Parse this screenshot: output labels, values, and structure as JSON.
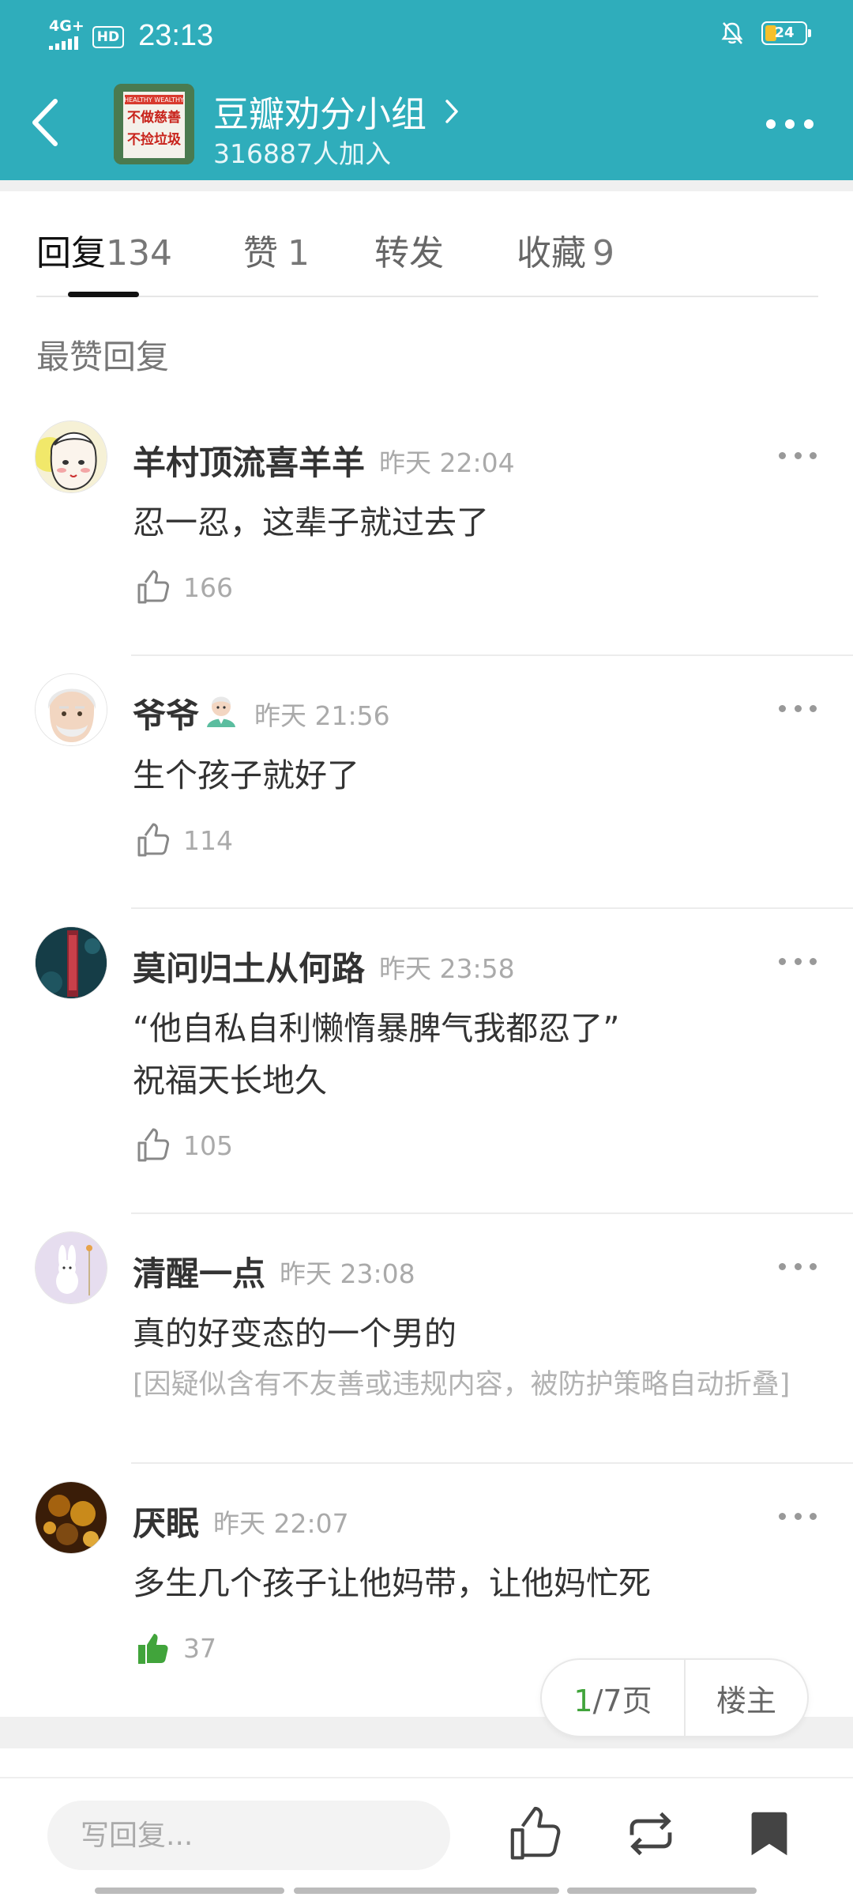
{
  "status_bar": {
    "network": "4G+",
    "hd": "HD",
    "time": "23:13",
    "battery": "24",
    "icons": [
      "signal-icon",
      "bell-off-icon",
      "battery-icon"
    ]
  },
  "header": {
    "group_name": "豆瓣劝分小组",
    "members": "316887人加入",
    "group_avatar_text": [
      "HEALTHY WEALTHY",
      "不做慈善",
      "不捡垃圾"
    ],
    "colors": {
      "header_bg": "#2fadbb"
    }
  },
  "tabs": [
    {
      "label": "回复",
      "count": "134"
    },
    {
      "label": "赞",
      "count": "1"
    },
    {
      "label": "转发",
      "count": ""
    },
    {
      "label": "收藏",
      "count": "9"
    }
  ],
  "section_title": "最赞回复",
  "comments": [
    {
      "name": "羊村顶流喜羊羊",
      "time": "昨天 22:04",
      "text": [
        "忍一忍，这辈子就过去了"
      ],
      "likes": "166",
      "liked": false
    },
    {
      "name": "爷爷",
      "emoji": "👨🏻‍⚕️",
      "time": "昨天 21:56",
      "text": [
        "生个孩子就好了"
      ],
      "likes": "114",
      "liked": false
    },
    {
      "name": "莫问归土从何路",
      "time": "昨天 23:58",
      "text": [
        "“他自私自利懒惰暴脾气我都忍了”",
        "祝福天长地久"
      ],
      "likes": "105",
      "liked": false
    },
    {
      "name": "清醒一点",
      "time": "昨天 23:08",
      "text": [
        "真的好变态的一个男的"
      ],
      "folded": "[因疑似含有不友善或违规内容，被防护策略自动折叠]",
      "liked": false
    },
    {
      "name": "厌眠",
      "time": "昨天 22:07",
      "text": [
        "多生几个孩子让他妈带，让他妈忙死"
      ],
      "likes": "37",
      "liked": true
    }
  ],
  "pager": {
    "current": "1",
    "total_suffix": "/7页",
    "op_label": "楼主"
  },
  "bottom_bar": {
    "reply_placeholder": "写回复...",
    "icons": [
      "thumbs-up-icon",
      "repost-icon",
      "bookmark-icon"
    ]
  },
  "colors": {
    "like_active": "#41a43b",
    "accent_page": "#41a43b"
  }
}
